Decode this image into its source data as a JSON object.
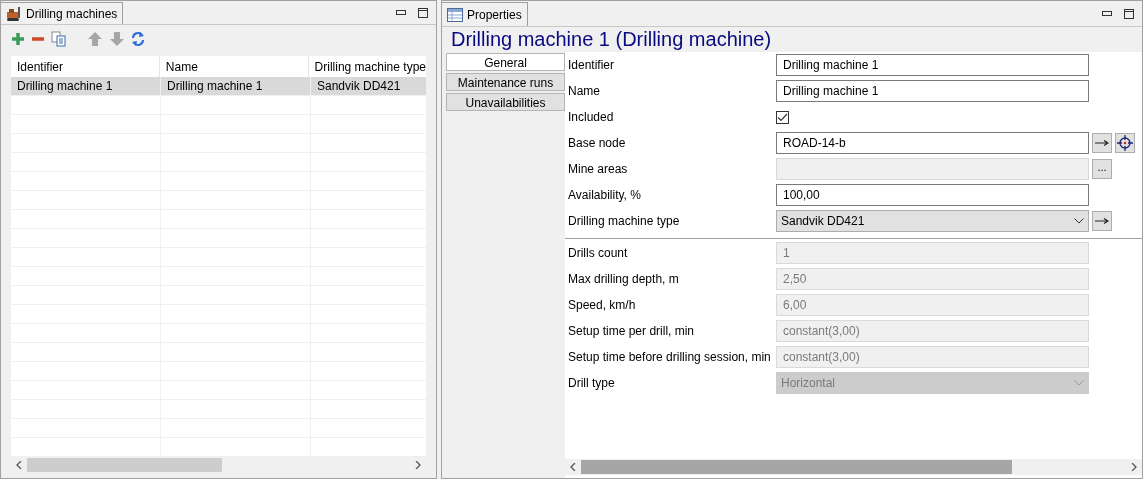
{
  "left_panel": {
    "title": "Drilling machines",
    "table": {
      "columns": [
        "Identifier",
        "Name",
        "Drilling machine type"
      ],
      "rows": [
        {
          "cells": [
            "Drilling machine 1",
            "Drilling machine 1",
            "Sandvik DD421"
          ],
          "selected": true
        }
      ]
    }
  },
  "right_panel": {
    "title": "Properties",
    "heading": "Drilling machine 1 (Drilling machine)",
    "sections": [
      {
        "label": "General",
        "selected": true
      },
      {
        "label": "Maintenance runs",
        "selected": false
      },
      {
        "label": "Unavailabilities",
        "selected": false
      }
    ],
    "field_groups": [
      [
        {
          "label": "Identifier",
          "kind": "text",
          "value": "Drilling machine 1",
          "disabled": false
        },
        {
          "label": "Name",
          "kind": "text",
          "value": "Drilling machine 1",
          "disabled": false
        },
        {
          "label": "Included",
          "kind": "checkbox",
          "checked": true
        },
        {
          "label": "Base node",
          "kind": "text",
          "value": "ROAD-14-b",
          "disabled": false,
          "buttons": [
            {
              "kind": "goto"
            },
            {
              "kind": "locate"
            }
          ]
        },
        {
          "label": "Mine areas",
          "kind": "text",
          "disabled": true,
          "buttons": [
            {
              "kind": "browse",
              "label": "..."
            }
          ]
        },
        {
          "label": "Availability, %",
          "kind": "text",
          "value": "100,00",
          "disabled": false
        },
        {
          "label": "Drilling machine type",
          "kind": "combo",
          "value": "Sandvik DD421",
          "disabled": false,
          "buttons": [
            {
              "kind": "goto"
            }
          ]
        }
      ],
      [
        {
          "label": "Drills count",
          "kind": "text",
          "value": "1",
          "disabled": true
        },
        {
          "label": "Max drilling depth, m",
          "kind": "text",
          "value": "2,50",
          "disabled": true
        },
        {
          "label": "Speed, km/h",
          "kind": "text",
          "value": "6,00",
          "disabled": true
        },
        {
          "label": "Setup time per drill, min",
          "kind": "text",
          "value": "constant(3,00)",
          "disabled": true
        },
        {
          "label": "Setup time before drilling session, min",
          "kind": "text",
          "value": "constant(3,00)",
          "disabled": true
        },
        {
          "label": "Drill type",
          "kind": "combo",
          "value": "Horizontal",
          "disabled": true
        }
      ]
    ]
  }
}
